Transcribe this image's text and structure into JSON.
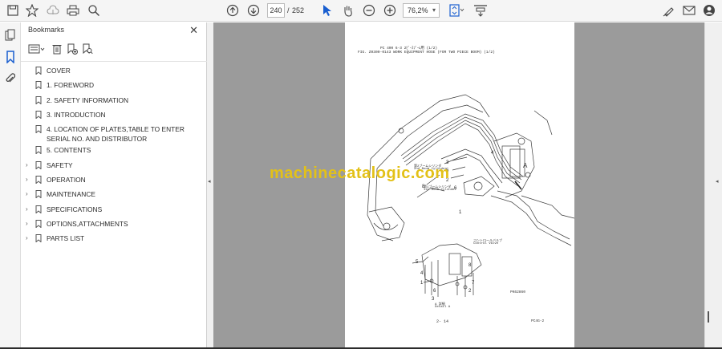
{
  "toolbar": {
    "current_page": "240",
    "page_separator": "/",
    "total_pages": "252",
    "zoom": "76,2%"
  },
  "bookmarks": {
    "title": "Bookmarks",
    "items": [
      {
        "label": "COVER",
        "expandable": false
      },
      {
        "label": "1. FOREWORD",
        "expandable": false
      },
      {
        "label": "2. SAFETY INFORMATION",
        "expandable": false
      },
      {
        "label": "3. INTRODUCTION",
        "expandable": false
      },
      {
        "label": "4. LOCATION OF PLATES,TABLE TO ENTER SERIAL NO. AND DISTRIBUTOR",
        "expandable": false
      },
      {
        "label": "5. CONTENTS",
        "expandable": false
      },
      {
        "label": "SAFETY",
        "expandable": true
      },
      {
        "label": "OPERATION",
        "expandable": true
      },
      {
        "label": "MAINTENANCE",
        "expandable": true
      },
      {
        "label": "SPECIFICATIONS",
        "expandable": true
      },
      {
        "label": "OPTIONS,ATTACHMENTS",
        "expandable": true
      },
      {
        "label": "PARTS LIST",
        "expandable": true
      }
    ]
  },
  "document": {
    "header_line1": "PC 400  6-3  2ﾋﾟｰｽﾌﾞｰﾑ用  (1/2)",
    "header_line2": "FIG. Z0300-0143  WORK EQUIPMENT HOSE (FOR TWO PIECE BOOM) (1/2)",
    "label_2nd_boom_cyl_jp": "第2ブームシリンダ",
    "label_2nd_boom_cyl": "2nd Boom Cylinder",
    "label_1st_boom_cyl_jp": "第1ブームシリンダ",
    "label_1st_boom_cyl": "1st Boom Cylinder",
    "label_control_valve_jp": "コントロールバルブ",
    "label_control_valve": "Control Valve",
    "label_detail_jp": "A 詳細",
    "label_detail": "Detail A",
    "callout_a": "A",
    "code": "PK62860",
    "page_number": "2- 14",
    "page_code": "PC4G-2",
    "watermark": "machinecatalogic.com"
  }
}
